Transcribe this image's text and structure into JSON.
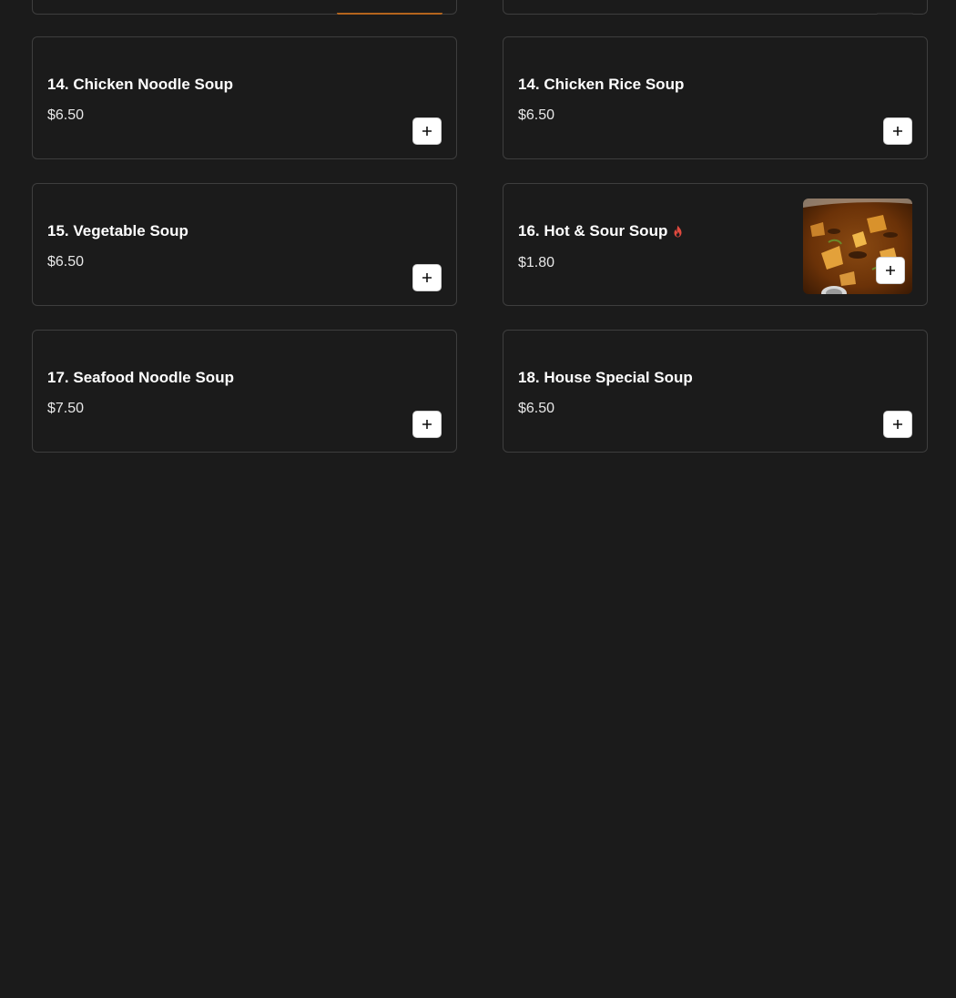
{
  "menu_items": [
    {
      "title": "14. Chicken Noodle Soup",
      "price": "$6.50"
    },
    {
      "title": "14. Chicken Rice Soup",
      "price": "$6.50"
    },
    {
      "title": "15. Vegetable Soup",
      "price": "$6.50"
    },
    {
      "title": "16. Hot & Sour Soup",
      "price": "$1.80",
      "spicy": true,
      "icon": "flame-icon"
    },
    {
      "title": "17. Seafood Noodle Soup",
      "price": "$7.50"
    },
    {
      "title": "18. House Special Soup",
      "price": "$6.50"
    }
  ],
  "add_button_icon": "plus-icon",
  "colors": {
    "background": "#1b1b1b",
    "card_border": "#3e3e3e",
    "spicy": "#e04a3f"
  }
}
